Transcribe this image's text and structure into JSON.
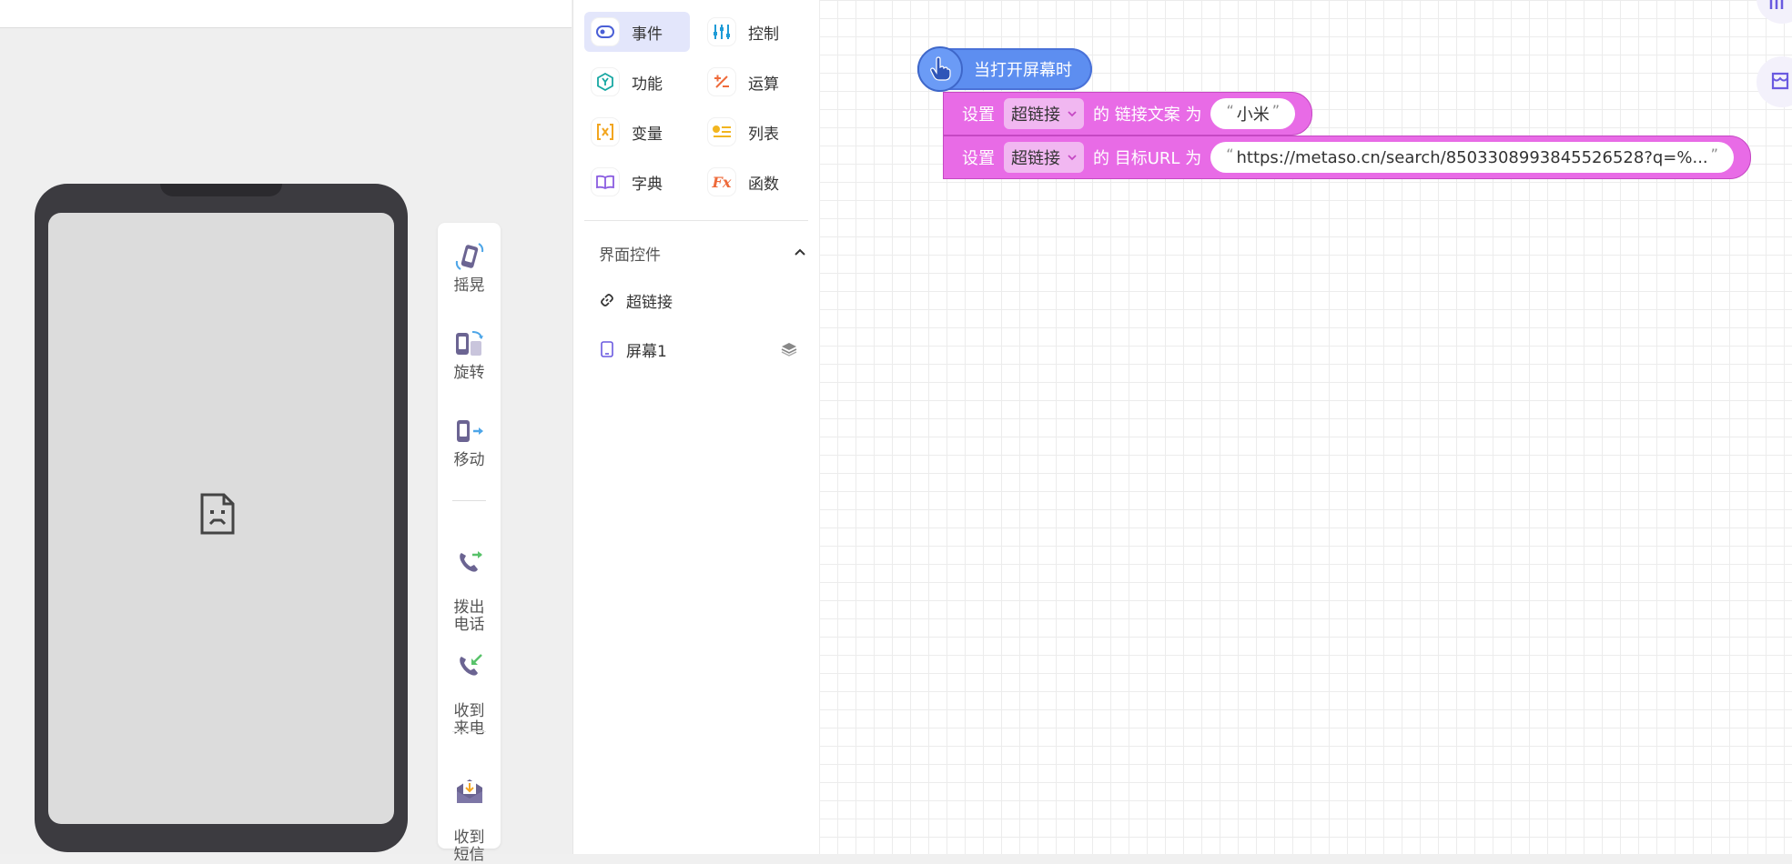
{
  "motion_items": [
    {
      "label": "摇晃",
      "icon": "shake-phone-icon"
    },
    {
      "label": "旋转",
      "icon": "rotate-phone-icon"
    },
    {
      "label": "移动",
      "icon": "move-phone-icon"
    },
    {
      "label": "拨出\n电话",
      "icon": "outgoing-call-icon"
    },
    {
      "label": "收到\n来电",
      "icon": "incoming-call-icon"
    },
    {
      "label": "收到\n短信",
      "icon": "sms-envelope-icon"
    }
  ],
  "categories": [
    {
      "label": "事件",
      "icon": "toggle-icon",
      "active": true
    },
    {
      "label": "控制",
      "icon": "sliders-icon"
    },
    {
      "label": "功能",
      "icon": "hexagon-y-icon"
    },
    {
      "label": "运算",
      "icon": "plus-minus-icon"
    },
    {
      "label": "变量",
      "icon": "x-bracket-icon"
    },
    {
      "label": "列表",
      "icon": "list-icon"
    },
    {
      "label": "字典",
      "icon": "book-icon"
    },
    {
      "label": "函数",
      "icon": "fx-icon"
    }
  ],
  "components_section": {
    "title": "界面控件",
    "items": [
      {
        "label": "超链接",
        "icon": "link-icon"
      },
      {
        "label": "屏幕1",
        "icon": "phone-screen-icon"
      }
    ]
  },
  "workspace": {
    "hat_label": "当打开屏幕时",
    "stmt1": {
      "set": "设置",
      "component": "超链接",
      "of": "的",
      "prop": "链接文案",
      "to": "为",
      "value": "小米"
    },
    "stmt2": {
      "set": "设置",
      "component": "超链接",
      "of": "的",
      "prop": "目标URL",
      "to": "为",
      "value": "https://metaso.cn/search/8503308993845526528?q=%..."
    }
  },
  "colors": {
    "event_block": "#5d8ef0",
    "component_block": "#e86be6",
    "active_category_bg": "#e3e6fb"
  }
}
